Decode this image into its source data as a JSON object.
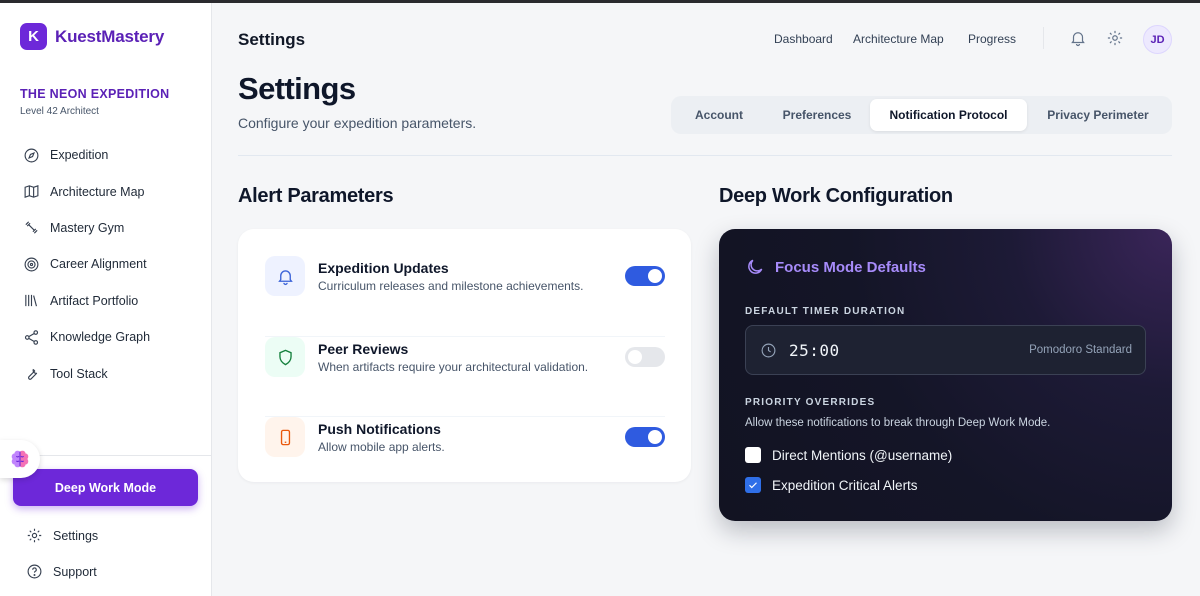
{
  "brand": {
    "logo_letter": "K",
    "name": "KuestMastery"
  },
  "expedition": {
    "title": "THE NEON EXPEDITION",
    "subtitle": "Level 42 Architect"
  },
  "sidebar": {
    "items": [
      {
        "label": "Expedition",
        "icon": "compass-icon"
      },
      {
        "label": "Architecture Map",
        "icon": "map-icon"
      },
      {
        "label": "Mastery Gym",
        "icon": "dumbbell-icon"
      },
      {
        "label": "Career Alignment",
        "icon": "target-icon"
      },
      {
        "label": "Artifact Portfolio",
        "icon": "library-icon"
      },
      {
        "label": "Knowledge Graph",
        "icon": "share-graph-icon"
      },
      {
        "label": "Tool Stack",
        "icon": "wrench-icon"
      }
    ],
    "cta_label": "Deep Work Mode",
    "settings_label": "Settings",
    "support_label": "Support"
  },
  "topbar": {
    "title": "Settings",
    "links": [
      "Dashboard",
      "Architecture Map",
      "Progress"
    ],
    "avatar_initials": "JD"
  },
  "page": {
    "title": "Settings",
    "subtitle": "Configure your expedition parameters."
  },
  "tabs": [
    {
      "label": "Account",
      "active": false
    },
    {
      "label": "Preferences",
      "active": false
    },
    {
      "label": "Notification Protocol",
      "active": true
    },
    {
      "label": "Privacy Perimeter",
      "active": false
    }
  ],
  "alerts": {
    "title": "Alert Parameters",
    "items": [
      {
        "title": "Expedition Updates",
        "desc": "Curriculum releases and milestone achievements.",
        "enabled": true,
        "icon": "bell-icon"
      },
      {
        "title": "Peer Reviews",
        "desc": "When artifacts require your architectural validation.",
        "enabled": false,
        "icon": "shield-icon"
      },
      {
        "title": "Push Notifications",
        "desc": "Allow mobile app alerts.",
        "enabled": true,
        "icon": "smartphone-icon"
      }
    ]
  },
  "deep_work": {
    "title": "Deep Work Configuration",
    "card_title": "Focus Mode Defaults",
    "timer_label": "DEFAULT TIMER DURATION",
    "timer_value": "25:00",
    "timer_note": "Pomodoro Standard",
    "overrides_label": "PRIORITY OVERRIDES",
    "overrides_desc": "Allow these notifications to break through Deep Work Mode.",
    "overrides": [
      {
        "label": "Direct Mentions (@username)",
        "checked": false
      },
      {
        "label": "Expedition Critical Alerts",
        "checked": true
      }
    ]
  },
  "colors": {
    "brand": "#6d28d9",
    "toggle_on": "#2f5be0",
    "dark_card": "#141527",
    "accent_violet": "#a78bfa"
  }
}
